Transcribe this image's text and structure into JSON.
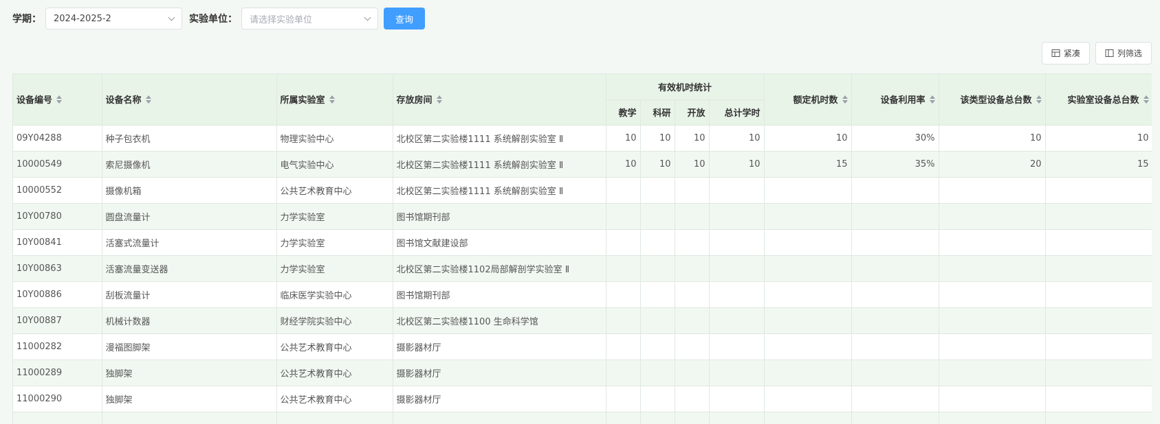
{
  "filters": {
    "term_label": "学期：",
    "term_value": "2024-2025-2",
    "unit_label": "实验单位：",
    "unit_placeholder": "请选择实验单位",
    "query_label": "查询"
  },
  "toolbar": {
    "compact_label": "紧凑",
    "column_filter_label": "列筛选"
  },
  "table": {
    "headers": {
      "device_no": "设备编号",
      "device_name": "设备名称",
      "lab": "所属实验室",
      "room": "存放房间",
      "effective_hours": "有效机时统计",
      "teaching": "教学",
      "research": "科研",
      "open": "开放",
      "total_hours": "总计学时",
      "rated_hours": "额定机时数",
      "utilization": "设备利用率",
      "type_total": "该类型设备总台数",
      "lab_total": "实验室设备总台数"
    },
    "rows": [
      {
        "device_no": "09Y04288",
        "device_name": "种子包衣机",
        "lab": "物理实验中心",
        "room": "北校区第二实验楼1111 系统解剖实验室 Ⅱ",
        "teaching": "10",
        "research": "10",
        "open": "10",
        "total_hours": "10",
        "rated_hours": "10",
        "utilization": "30%",
        "type_total": "10",
        "lab_total": "10"
      },
      {
        "device_no": "10000549",
        "device_name": "索尼摄像机",
        "lab": "电气实验中心",
        "room": "北校区第二实验楼1111 系统解剖实验室 Ⅱ",
        "teaching": "10",
        "research": "10",
        "open": "10",
        "total_hours": "10",
        "rated_hours": "15",
        "utilization": "35%",
        "type_total": "20",
        "lab_total": "15"
      },
      {
        "device_no": "10000552",
        "device_name": "摄像机箱",
        "lab": "公共艺术教育中心",
        "room": "北校区第二实验楼1111 系统解剖实验室 Ⅱ",
        "teaching": "",
        "research": "",
        "open": "",
        "total_hours": "",
        "rated_hours": "",
        "utilization": "",
        "type_total": "",
        "lab_total": ""
      },
      {
        "device_no": "10Y00780",
        "device_name": "圆盘流量计",
        "lab": "力学实验室",
        "room": "图书馆期刊部",
        "teaching": "",
        "research": "",
        "open": "",
        "total_hours": "",
        "rated_hours": "",
        "utilization": "",
        "type_total": "",
        "lab_total": ""
      },
      {
        "device_no": "10Y00841",
        "device_name": "活塞式流量计",
        "lab": "力学实验室",
        "room": "图书馆文献建设部",
        "teaching": "",
        "research": "",
        "open": "",
        "total_hours": "",
        "rated_hours": "",
        "utilization": "",
        "type_total": "",
        "lab_total": ""
      },
      {
        "device_no": "10Y00863",
        "device_name": "活塞流量变送器",
        "lab": "力学实验室",
        "room": "北校区第二实验楼1102局部解剖学实验室 Ⅱ",
        "teaching": "",
        "research": "",
        "open": "",
        "total_hours": "",
        "rated_hours": "",
        "utilization": "",
        "type_total": "",
        "lab_total": ""
      },
      {
        "device_no": "10Y00886",
        "device_name": "刮板流量计",
        "lab": "临床医学实验中心",
        "room": "图书馆期刊部",
        "teaching": "",
        "research": "",
        "open": "",
        "total_hours": "",
        "rated_hours": "",
        "utilization": "",
        "type_total": "",
        "lab_total": ""
      },
      {
        "device_no": "10Y00887",
        "device_name": "机械计数器",
        "lab": "财经学院实验中心",
        "room": "北校区第二实验楼1100 生命科学馆",
        "teaching": "",
        "research": "",
        "open": "",
        "total_hours": "",
        "rated_hours": "",
        "utilization": "",
        "type_total": "",
        "lab_total": ""
      },
      {
        "device_no": "11000282",
        "device_name": "漫福图脚架",
        "lab": "公共艺术教育中心",
        "room": "摄影器材厅",
        "teaching": "",
        "research": "",
        "open": "",
        "total_hours": "",
        "rated_hours": "",
        "utilization": "",
        "type_total": "",
        "lab_total": ""
      },
      {
        "device_no": "11000289",
        "device_name": "独脚架",
        "lab": "公共艺术教育中心",
        "room": "摄影器材厅",
        "teaching": "",
        "research": "",
        "open": "",
        "total_hours": "",
        "rated_hours": "",
        "utilization": "",
        "type_total": "",
        "lab_total": ""
      },
      {
        "device_no": "11000290",
        "device_name": "独脚架",
        "lab": "公共艺术教育中心",
        "room": "摄影器材厅",
        "teaching": "",
        "research": "",
        "open": "",
        "total_hours": "",
        "rated_hours": "",
        "utilization": "",
        "type_total": "",
        "lab_total": ""
      },
      {
        "device_no": "",
        "device_name": "",
        "lab": "",
        "room": "",
        "teaching": "",
        "research": "",
        "open": "",
        "total_hours": "",
        "rated_hours": "",
        "utilization": "",
        "type_total": "",
        "lab_total": ""
      }
    ]
  }
}
